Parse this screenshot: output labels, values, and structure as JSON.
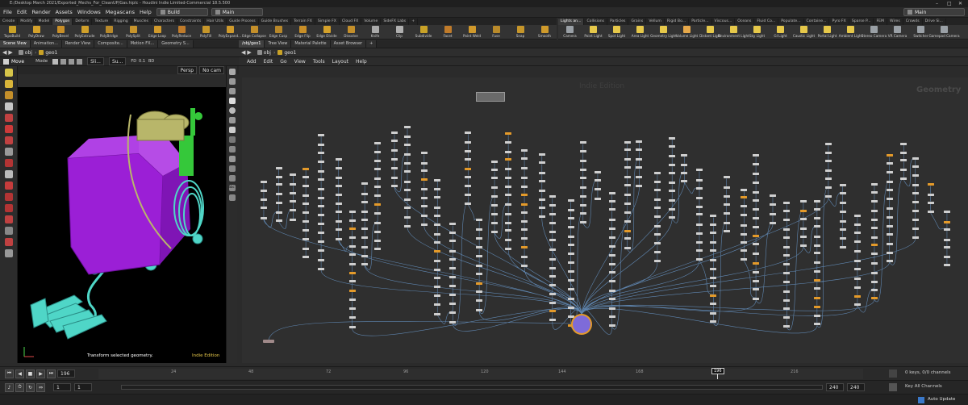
{
  "window": {
    "title": "E:/Desktop March 2021/Exported_Mechs_For_CleanUP/Gas.hiplc - Houdini Indie Limited-Commercial 18.5.500",
    "controls": [
      "–",
      "□",
      "✕"
    ]
  },
  "menubar": {
    "items": [
      "File",
      "Edit",
      "Render",
      "Assets",
      "Windows",
      "Megascans",
      "Help"
    ],
    "desktop_left": "Build",
    "desktop_mid": "Main",
    "desktop_right": "Main"
  },
  "shelf_left": {
    "tabs": [
      "Create",
      "Modify",
      "Model",
      "Polygon",
      "Deform",
      "Texture",
      "Rigging",
      "Muscles",
      "Characters",
      "Constraints",
      "Hair Utils",
      "Guide Process",
      "Guide Brushes",
      "Terrain FX",
      "Simple FX",
      "Cloud FX",
      "Volume",
      "SideFX Labs",
      "+"
    ],
    "active_tab": 3,
    "tools": [
      {
        "label": "TopoBuild",
        "color": "#c9a227"
      },
      {
        "label": "PolyDraw",
        "color": "#d4a12b"
      },
      {
        "label": "PolyBevel",
        "color": "#c98f27"
      },
      {
        "label": "PolyExtrude",
        "color": "#d0a02a"
      },
      {
        "label": "PolyBridge",
        "color": "#b98a2a"
      },
      {
        "label": "PolySplit",
        "color": "#c7942c"
      },
      {
        "label": "Edge Loop",
        "color": "#d0992b"
      },
      {
        "label": "PolyReduce",
        "color": "#c07b2a"
      },
      {
        "label": "PolyFill",
        "color": "#c6962a"
      },
      {
        "label": "PolyExpand...",
        "color": "#cf9a2b"
      },
      {
        "label": "Edge Collapse",
        "color": "#c48f2a"
      },
      {
        "label": "Edge Cusp",
        "color": "#b8882a"
      },
      {
        "label": "Edge Flip",
        "color": "#c98f27"
      },
      {
        "label": "Edge Divide",
        "color": "#d4a12b"
      },
      {
        "label": "Dissolve",
        "color": "#c48f2a"
      },
      {
        "label": "Knife",
        "color": "#aaaaaa"
      },
      {
        "label": "Clip",
        "color": "#b0b0b0"
      },
      {
        "label": "Subdivide",
        "color": "#c9a227"
      },
      {
        "label": "Facet",
        "color": "#c07b2a"
      },
      {
        "label": "Point Weld",
        "color": "#d0992b"
      },
      {
        "label": "Fuse",
        "color": "#b98a2a"
      },
      {
        "label": "Snap",
        "color": "#c6962a"
      },
      {
        "label": "Smooth",
        "color": "#cf9a2b"
      }
    ]
  },
  "shelf_right": {
    "tabs": [
      "Lights an...",
      "Collisions",
      "Particles",
      "Grains",
      "Vellum",
      "Rigid Bo...",
      "Particle...",
      "Viscous...",
      "Oceans",
      "Fluid Co...",
      "Populate...",
      "Containe...",
      "Pyro FX",
      "Sparse P...",
      "FEM",
      "Wires",
      "Crowds",
      "Drive Si..."
    ],
    "active_tab": 0,
    "tools": [
      {
        "label": "Camera",
        "color": "#9aa0a6"
      },
      {
        "label": "Point Light",
        "color": "#e6c84a"
      },
      {
        "label": "Spot Light",
        "color": "#e6c84a"
      },
      {
        "label": "Area Light",
        "color": "#e6c84a"
      },
      {
        "label": "Geometry Light",
        "color": "#e6c84a"
      },
      {
        "label": "Volume Light",
        "color": "#e6a84a"
      },
      {
        "label": "Distant Light",
        "color": "#e6c84a"
      },
      {
        "label": "Environment Light",
        "color": "#e6c84a"
      },
      {
        "label": "Sky Light",
        "color": "#e6c84a"
      },
      {
        "label": "GI Light",
        "color": "#e6c84a"
      },
      {
        "label": "Caustic Light",
        "color": "#e6c84a"
      },
      {
        "label": "Portal Light",
        "color": "#e6c84a"
      },
      {
        "label": "Ambient Light",
        "color": "#e6c84a"
      },
      {
        "label": "Stereo Camera",
        "color": "#9aa0a6"
      },
      {
        "label": "VR Camera",
        "color": "#9aa0a6"
      },
      {
        "label": "Switcher",
        "color": "#9aa0a6"
      },
      {
        "label": "Gamepad Camera",
        "color": "#9aa0a6"
      }
    ]
  },
  "left_pane": {
    "tabs": [
      "Scene View",
      "Animation...",
      "Render View",
      "Composite...",
      "Motion FX...",
      "Geometry S..."
    ],
    "active_tab": 0,
    "path": [
      "obj",
      "geo1"
    ],
    "tool_name": "Move",
    "mode_label": "Mode",
    "select_field": "Sli...",
    "su_field": "Su...",
    "persp": "Persp",
    "cam": "No cam",
    "fd": "FD",
    "frame_a": "0.1",
    "bd": "BD",
    "status_msg": "Transform selected geometry.",
    "edition": "Indie Edition"
  },
  "right_pane": {
    "tabs": [
      "/obj/geo1",
      "Tree View",
      "Material Palette",
      "Asset Browser",
      "+"
    ],
    "active_tab": 0,
    "path": [
      "obj",
      "geo1"
    ],
    "menus": [
      "Add",
      "Edit",
      "Go",
      "View",
      "Tools",
      "Layout",
      "Help"
    ],
    "watermark": "Indie Edition",
    "context_label": "Geometry"
  },
  "timeline": {
    "current_frame": "196",
    "ticks": [
      "24",
      "48",
      "72",
      "96",
      "120",
      "144",
      "168",
      "192",
      "216"
    ],
    "marker": "196",
    "range_start": "1",
    "range_start2": "1",
    "range_end": "240",
    "range_end2": "240",
    "keys_label": "0 keys, 0/0 channels",
    "all_channels": "Key All Channels",
    "auto_update": "Auto Update"
  },
  "colors": {
    "purple_body": "#9b1fd6",
    "cyan_cable": "#4fd6c7",
    "olive_frame": "#b8b66a",
    "green_tank": "#35c83a",
    "accent_node": "#7e6bd9"
  }
}
